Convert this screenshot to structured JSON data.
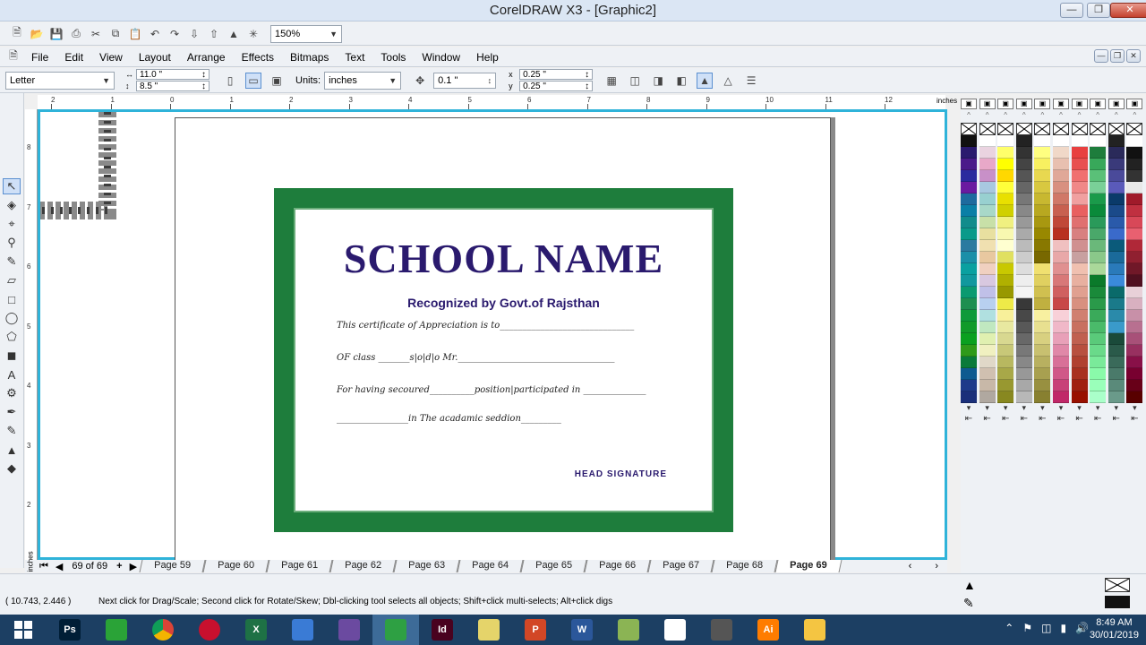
{
  "window": {
    "title": "CorelDRAW X3 - [Graphic2]"
  },
  "standard_toolbar": {
    "zoom": "150%"
  },
  "menu": [
    "File",
    "Edit",
    "View",
    "Layout",
    "Arrange",
    "Effects",
    "Bitmaps",
    "Text",
    "Tools",
    "Window",
    "Help"
  ],
  "property_bar": {
    "paper": "Letter",
    "width": "11.0 \"",
    "height": "8.5 \"",
    "units_label": "Units:",
    "units": "inches",
    "nudge": "0.1 \"",
    "dup_x": "0.25 \"",
    "dup_y": "0.25 \""
  },
  "ruler": {
    "h_labels": [
      "2",
      "1",
      "0",
      "1",
      "2",
      "3",
      "4",
      "5",
      "6",
      "7",
      "8",
      "9",
      "10",
      "11",
      "12"
    ],
    "unit": "inches",
    "v_labels": [
      "8",
      "7",
      "6",
      "5",
      "4",
      "3",
      "2"
    ]
  },
  "certificate": {
    "school_name": "SCHOOL NAME",
    "recognized": "Recognized by Govt.of Rajsthan",
    "line1": "This certificate of Appreciation is to______________________________",
    "line2": "OF class _______s|o|d|o Mr.___________________________________",
    "line3": "For having secoured__________position|participated in ______________",
    "line4": "________________in The acadamic seddion_________",
    "signature": "HEAD SIGNATURE"
  },
  "pages": {
    "counter": "69 of 69",
    "tabs": [
      "Page 59",
      "Page 60",
      "Page 61",
      "Page 62",
      "Page 63",
      "Page 64",
      "Page 65",
      "Page 66",
      "Page 67",
      "Page 68",
      "Page 69"
    ],
    "active": "Page 69"
  },
  "status": {
    "coords": "( 10.743, 2.446 )",
    "hint": "Next click for Drag/Scale; Second click for Rotate/Skew; Dbl-clicking tool selects all objects; Shift+click multi-selects; Alt+click digs"
  },
  "tray": {
    "time": "8:49 AM",
    "date": "30/01/2019"
  },
  "taskbar_apps": [
    {
      "name": "start",
      "label": ""
    },
    {
      "name": "photoshop",
      "label": "Ps",
      "color": "#001e36"
    },
    {
      "name": "store",
      "label": "",
      "color": "#2aa337"
    },
    {
      "name": "chrome",
      "label": "",
      "color": "#ffffff"
    },
    {
      "name": "opera",
      "label": "",
      "color": "#c8102e"
    },
    {
      "name": "excel",
      "label": "X",
      "color": "#1e7145"
    },
    {
      "name": "camera",
      "label": "",
      "color": "#3a7bd5"
    },
    {
      "name": "paint",
      "label": "",
      "color": "#6b4aa0"
    },
    {
      "name": "coreldraw",
      "label": "",
      "color": "#2ea043"
    },
    {
      "name": "indesign",
      "label": "Id",
      "color": "#49021f"
    },
    {
      "name": "messenger",
      "label": "",
      "color": "#e5d46a"
    },
    {
      "name": "powerpoint",
      "label": "P",
      "color": "#d24726"
    },
    {
      "name": "word",
      "label": "W",
      "color": "#2b579a"
    },
    {
      "name": "app-green",
      "label": "",
      "color": "#8bb454"
    },
    {
      "name": "notepad",
      "label": "",
      "color": "#ffffff"
    },
    {
      "name": "media",
      "label": "",
      "color": "#555555"
    },
    {
      "name": "illustrator",
      "label": "Ai",
      "color": "#ff7c00"
    },
    {
      "name": "explorer",
      "label": "",
      "color": "#f4c542"
    }
  ]
}
